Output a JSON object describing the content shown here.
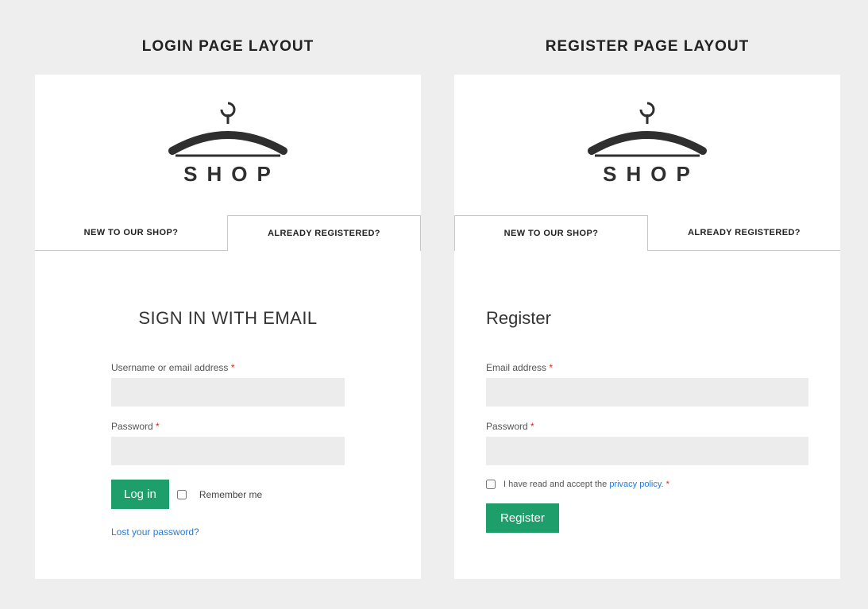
{
  "login": {
    "title": "LOGIN PAGE LAYOUT",
    "logo_text": "SHOP",
    "tab_new": "NEW TO OUR SHOP?",
    "tab_already": "ALREADY REGISTERED?",
    "heading": "SIGN IN WITH EMAIL",
    "username_label": "Username or email address ",
    "password_label": "Password ",
    "required_mark": "*",
    "login_button": "Log in",
    "remember_label": "Remember me",
    "lost_password": "Lost your password?"
  },
  "register": {
    "title": "REGISTER PAGE LAYOUT",
    "logo_text": "SHOP",
    "tab_new": "NEW TO OUR SHOP?",
    "tab_already": "ALREADY REGISTERED?",
    "heading": "Register",
    "email_label": "Email address ",
    "password_label": "Password ",
    "required_mark": "*",
    "consent_prefix": "I have read and accept the ",
    "consent_link": "privacy policy",
    "consent_suffix": ". ",
    "register_button": "Register"
  }
}
